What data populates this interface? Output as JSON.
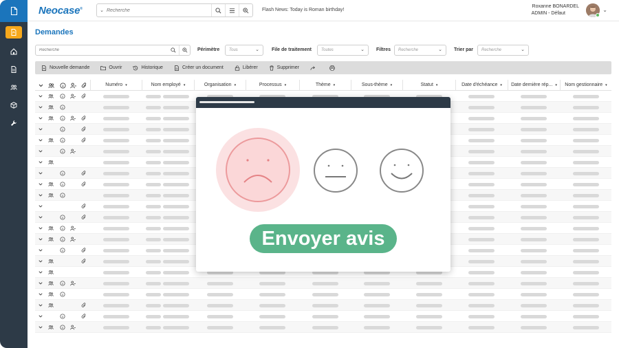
{
  "header": {
    "logo": "Neocase",
    "logo_mark": "®",
    "search_placeholder": "Recherche",
    "flash_news": "Flash News: Today is Roman birthday!",
    "user_name": "Roxanne  BONARDEL",
    "user_role": "ADMIN - Défaut"
  },
  "page": {
    "title": "Demandes",
    "search_placeholder": "Recherche"
  },
  "filters": {
    "perimetre_label": "Périmètre",
    "perimetre_value": "Tous",
    "file_label": "File de traitement",
    "file_value": "Toutes",
    "filtres_label": "Filtres",
    "filtres_value": "Recherche",
    "trier_label": "Trier par",
    "trier_value": "Recherche"
  },
  "toolbar": {
    "new_request": "Nouvelle demande",
    "open": "Ouvrir",
    "history": "Historique",
    "create_doc": "Créer un document",
    "release": "Libérer",
    "delete": "Supprimer"
  },
  "table": {
    "columns": [
      "Numéro",
      "Nom employé",
      "Organisation",
      "Processus",
      "Thème",
      "Sous-thème",
      "Statut",
      "Date d'échéance",
      "Date dernière rép...",
      "Nom gestionnaire"
    ],
    "row_count": 22
  },
  "modal": {
    "send_label": "Envoyer avis",
    "selected_face": "sad"
  },
  "colors": {
    "brand_blue": "#1b75bc",
    "sidebar": "#2d3a47",
    "accent_orange": "#f7a81b",
    "send_green": "#5ab48a",
    "sad_pink": "#f8d7d8"
  }
}
